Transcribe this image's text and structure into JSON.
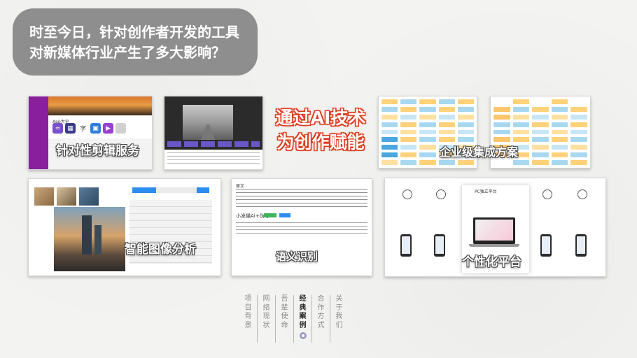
{
  "headline": {
    "line1": "时至今日，针对创作者开发的工具",
    "line2": "对新媒体行业产生了多大影响？"
  },
  "center_text": {
    "line1": "通过AI技术",
    "line2": "为创作赋能"
  },
  "cards": {
    "editing": {
      "caption": "针对性剪辑服务",
      "section_label": "App大全",
      "app_icon_char": "字"
    },
    "enterprise": {
      "caption": "企业级集成方案"
    },
    "image": {
      "caption": "智能图像分析"
    },
    "semantic": {
      "caption": "语义识别",
      "heading": "原文",
      "sub_heading": "小发猫Ai+伪号"
    },
    "personal": {
      "caption": "个性化平台",
      "feature_title": "PC独立平台"
    }
  },
  "nav": {
    "items": [
      {
        "label": "项目背景",
        "active": false
      },
      {
        "label": "网络现状",
        "active": false
      },
      {
        "label": "吾辈使命",
        "active": false
      },
      {
        "label": "经典案例",
        "active": true
      },
      {
        "label": "合作方式",
        "active": false
      },
      {
        "label": "关于我们",
        "active": false
      }
    ]
  },
  "colors": {
    "headline_bg": "#8e8e8e",
    "ai_text_outline": "#e03a1e",
    "nav_active_dot": "#9a9cc6"
  }
}
